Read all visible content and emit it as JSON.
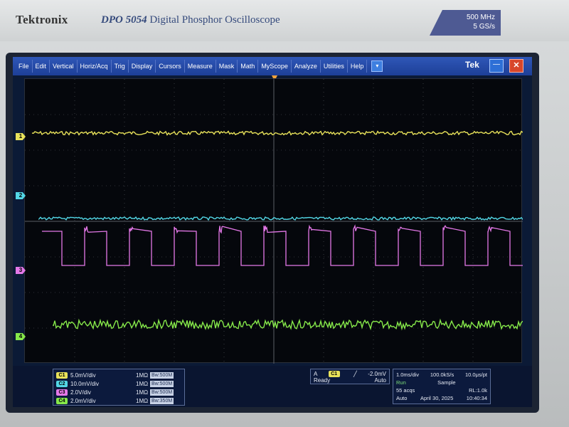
{
  "brand": {
    "logo": "Tektronix",
    "model_bold": "DPO 5054",
    "model_desc": "Digital Phosphor Oscilloscope",
    "spec_bw": "500 MHz",
    "spec_rate": "5 GS/s"
  },
  "menu": {
    "items": [
      "File",
      "Edit",
      "Vertical",
      "Horiz/Acq",
      "Trig",
      "Display",
      "Cursors",
      "Measure",
      "Mask",
      "Math",
      "MyScope",
      "Analyze",
      "Utilities",
      "Help"
    ],
    "dropdown_icon": "▾",
    "tek_label": "Tek",
    "minimize_icon": "—",
    "close_icon": "✕"
  },
  "channel_markers": [
    "1",
    "2",
    "3",
    "4"
  ],
  "channels": [
    {
      "tag": "C1",
      "scale": "5.0mV/div",
      "imp": "1MΩ",
      "bw": "Bw:500M",
      "color": "#e8e25a"
    },
    {
      "tag": "C2",
      "scale": "10.0mV/div",
      "imp": "1MΩ",
      "bw": "Bw:500M",
      "color": "#53d7e6"
    },
    {
      "tag": "C3",
      "scale": "2.0V/div",
      "imp": "1MΩ",
      "bw": "Bw:500M",
      "color": "#e478e8"
    },
    {
      "tag": "C4",
      "scale": "2.0mV/div",
      "imp": "1MΩ",
      "bw": "Bw:350M",
      "color": "#86e84a"
    }
  ],
  "trigger": {
    "mode_label": "A",
    "source": "C1",
    "slope_icon": "╱",
    "level": "-2.0mV",
    "state": "Ready",
    "coupling": "Auto"
  },
  "timebase": {
    "scale": "1.0ms/div",
    "rate": "100.0kS/s",
    "res": "10.0μs/pt",
    "run_state": "Run",
    "acq_mode": "Sample",
    "acqs": "55 acqs",
    "rl": "RL:1.0k",
    "mode": "Auto",
    "date": "April 30, 2025",
    "time": "10:40:34"
  }
}
